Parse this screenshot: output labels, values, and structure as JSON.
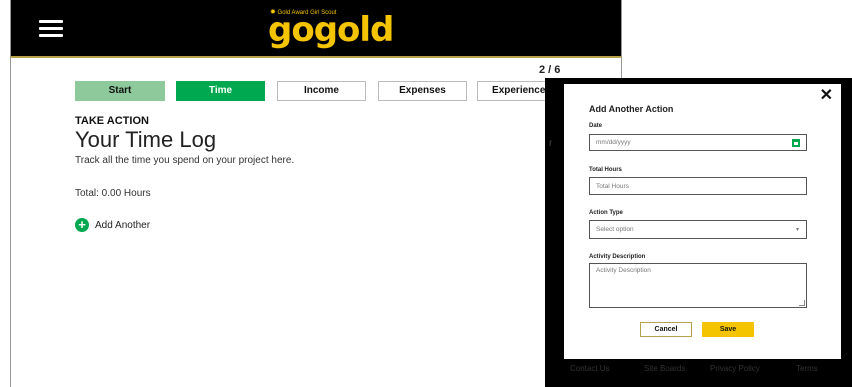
{
  "header": {
    "logo_small": "Gold Award Girl Scout",
    "logo_main": "gogold"
  },
  "progress": "2 / 6",
  "steps": [
    "Start",
    "Time",
    "Income",
    "Expenses",
    "Experiences"
  ],
  "content": {
    "eyebrow": "TAKE ACTION",
    "title": "Your Time Log",
    "subtitle": "Track all the time you spend on your project here.",
    "total": "Total: 0.00 Hours",
    "add_another": "Add Another"
  },
  "modal": {
    "title": "Add Another Action",
    "date_label": "Date",
    "date_placeholder": "mm/dd/yyyy",
    "hours_label": "Total Hours",
    "hours_placeholder": "Total Hours",
    "type_label": "Action Type",
    "type_selected": "Select option",
    "desc_label": "Activity Description",
    "desc_placeholder": "Activity Description",
    "cancel_label": "Cancel",
    "save_label": "Save"
  },
  "footer": {
    "links": [
      "Contact Us",
      "Site Boards",
      "Privacy Policy",
      "Terms"
    ]
  },
  "colors": {
    "brand_gold": "#f5c400",
    "step_active": "#00a94f",
    "step_done": "#8dc99a",
    "header_bg": "#000000"
  },
  "icons": [
    "hamburger-menu-icon",
    "add-circle-icon",
    "close-icon",
    "calendar-icon",
    "chevron-down-icon",
    "resize-handle-icon"
  ]
}
